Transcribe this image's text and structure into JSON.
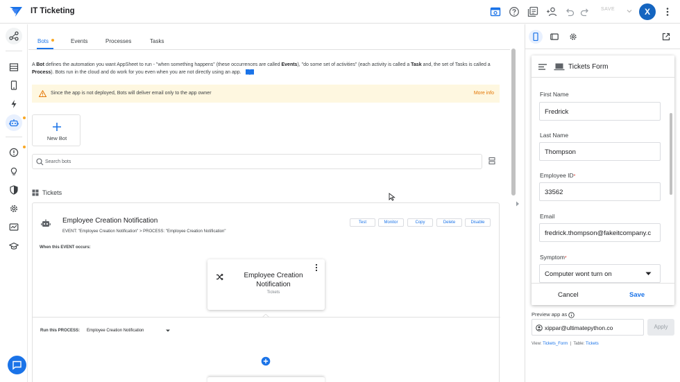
{
  "app": {
    "title": "IT Ticketing",
    "save_label": "SAVE",
    "avatar_letter": "X"
  },
  "tabs": [
    {
      "label": "Bots"
    },
    {
      "label": "Events"
    },
    {
      "label": "Processes"
    },
    {
      "label": "Tasks"
    }
  ],
  "description": {
    "p1": "A ",
    "b1": "Bot",
    "p2": " defines the automation you want AppSheet to run - \"when something happens\" (these occurrences are called ",
    "b2": "Events",
    "p3": "), \"do some set of activities\" (each activity is called a ",
    "b3": "Task",
    "p4": " and, the set of Tasks is called a ",
    "b4": "Process",
    "p5": "). Bots run in the cloud and do work for you even when you are not directly using an app."
  },
  "banner": {
    "text": "Since the app is not deployed, Bots will deliver email only to the app owner",
    "link": "More info"
  },
  "new_bot_label": "New Bot",
  "search_placeholder": "Search bots",
  "section_title": "Tickets",
  "bot": {
    "title": "Employee Creation Notification",
    "subtitle": "EVENT: \"Employee Creation Notification\" > PROCESS: \"Employee Creation Notification\"",
    "actions": [
      "Test",
      "Monitor",
      "Copy",
      "Delete",
      "Disable"
    ],
    "when_label": "When this EVENT occurs:",
    "event_title": "Employee Creation Notification",
    "event_table": "Tickets",
    "run_label": "Run this PROCESS:",
    "run_value": "Employee Creation Notification"
  },
  "preview": {
    "form_title": "Tickets Form",
    "fields": [
      {
        "label": "First Name",
        "value": "Fredrick",
        "required": ""
      },
      {
        "label": "Last Name",
        "value": "Thompson",
        "required": ""
      },
      {
        "label": "Employee ID",
        "value": "33562",
        "required": "*"
      },
      {
        "label": "Email",
        "value": "fredrick.thompson@fakeitcompany.c",
        "required": ""
      },
      {
        "label": "Symptom",
        "value": "Computer wont turn on",
        "required": "*"
      }
    ],
    "cancel_label": "Cancel",
    "save_label": "Save",
    "preview_as_label": "Preview app as",
    "preview_as_value": "xippar@ultimatepython.co",
    "apply_label": "Apply",
    "view_prefix": "View:",
    "view_value": "Tickets_Form",
    "table_prefix": "Table:",
    "table_value": "Tickets",
    "separator": "|"
  },
  "colors": {
    "accent": "#1a73e8",
    "warning_bg": "#fef7e0",
    "warning_text": "#e37400",
    "dot": "#f9a825"
  }
}
